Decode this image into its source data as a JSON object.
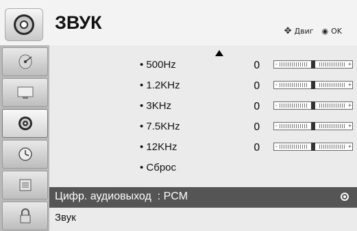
{
  "header": {
    "title": "ЗВУК",
    "move_icon": "move-arrows-icon",
    "move_label": "Двиг",
    "ok_icon": "ok-dot-icon",
    "ok_label": "OK"
  },
  "sidebar": {
    "items": [
      {
        "icon": "satellite-icon",
        "active": false
      },
      {
        "icon": "monitor-icon",
        "active": false
      },
      {
        "icon": "speaker-icon",
        "active": true
      },
      {
        "icon": "clock-icon",
        "active": false
      },
      {
        "icon": "options-icon",
        "active": false
      },
      {
        "icon": "lock-icon",
        "active": false
      }
    ]
  },
  "equalizer": {
    "bands": [
      {
        "label": "• 500Hz",
        "value": "0",
        "level": 0
      },
      {
        "label": "• 1.2KHz",
        "value": "0",
        "level": 0
      },
      {
        "label": "• 3KHz",
        "value": "0",
        "level": 0
      },
      {
        "label": "• 7.5KHz",
        "value": "0",
        "level": 0
      },
      {
        "label": "• 12KHz",
        "value": "0",
        "level": 0
      }
    ],
    "slider_minus": "-",
    "slider_plus": "+",
    "reset_label": "• Сброс"
  },
  "menu": {
    "digital_out_label": "Цифр. аудиовыход  : PCM",
    "sound_label": "Звук"
  },
  "colors": {
    "selected_row_bg": "#555555",
    "selected_row_text": "#ffffff",
    "sidebar_bg": "#b9b9b9"
  }
}
